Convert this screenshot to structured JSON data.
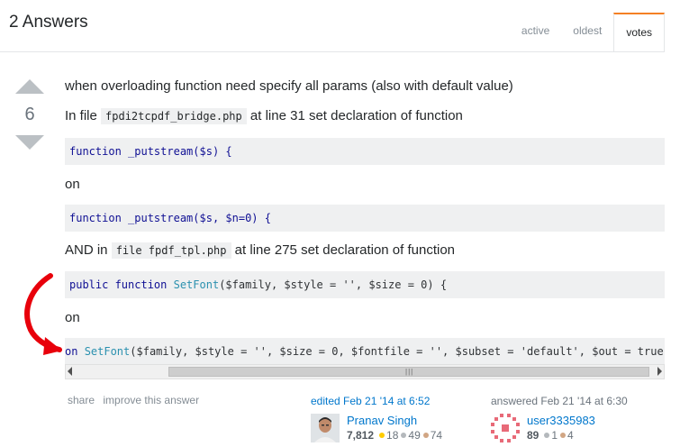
{
  "header": {
    "answers_count": "2 Answers",
    "tabs": [
      {
        "label": "active"
      },
      {
        "label": "oldest"
      },
      {
        "label": "votes"
      }
    ]
  },
  "vote": {
    "count": "6"
  },
  "post": {
    "line1": "when overloading function need specify all params (also with default value)",
    "line2_pre": "In file ",
    "line2_code": "fpdi2tcpdf_bridge.php",
    "line2_post": " at line 31 set declaration of function",
    "code1": "function _putstream($s) {",
    "on1": "on",
    "code2": "function _putstream($s, $n=0) {",
    "line3_pre": "AND in ",
    "line3_code": "file fpdf_tpl.php",
    "line3_post": " at line 275 set declaration of function",
    "code3_kw": "public function",
    "code3_fn": "SetFont",
    "code3_args": "($family, $style = '', $size = 0) {",
    "on2": "on",
    "code4_kw": "on",
    "code4_fn": "SetFont",
    "code4_args": "($family, $style = '', $size = 0, $fontfile = '', $subset = 'default', $out = true) {"
  },
  "post_menu": {
    "share": "share",
    "improve": "improve this answer"
  },
  "edited": {
    "action": "edited ",
    "time": "Feb 21 '14 at 6:52",
    "user": "Pranav Singh",
    "rep": "7,812",
    "gold": "18",
    "silver": "49",
    "bronze": "74"
  },
  "answered": {
    "action": "answered Feb 21 '14 at 6:30",
    "user": "user3335983",
    "rep": "89",
    "silver": "1",
    "bronze": "4"
  },
  "colors": {
    "accent": "#f48024",
    "link": "#0077cc",
    "gold": "#ffcc01",
    "silver": "#b4b8bc",
    "bronze": "#d1a684",
    "arrow": "#e8000b"
  }
}
